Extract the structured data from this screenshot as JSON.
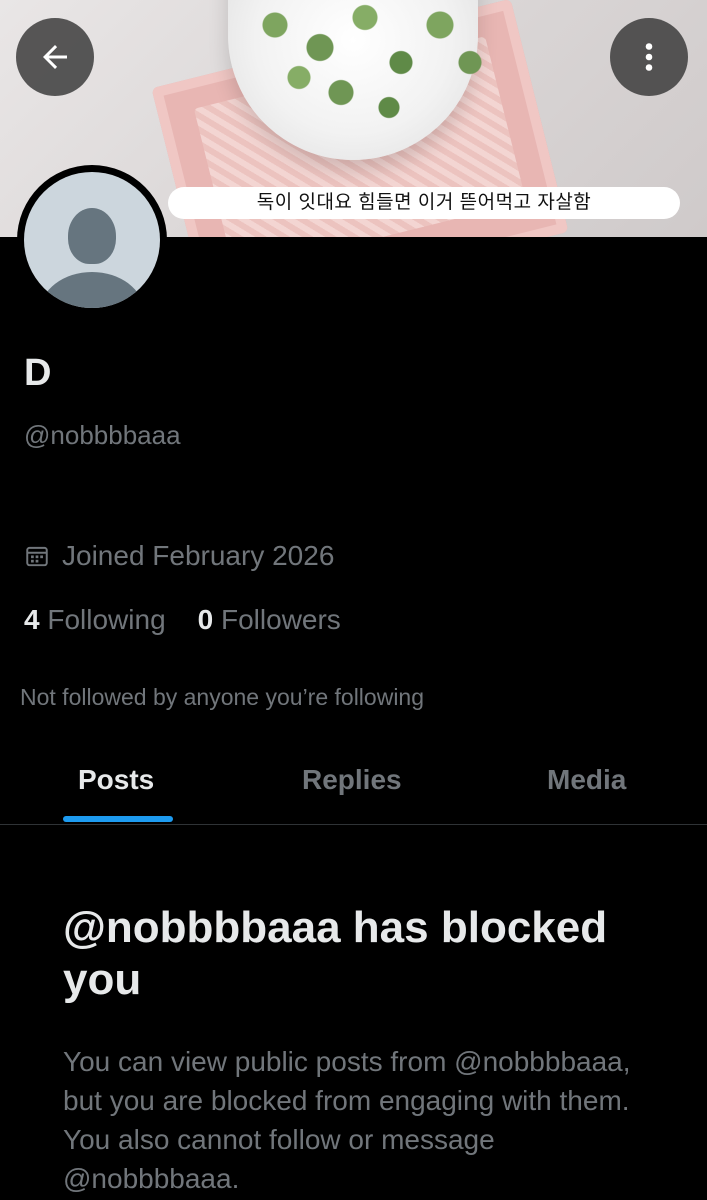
{
  "banner": {
    "caption": "독이 잇대요 힘들면 이거 뜯어먹고 자살함"
  },
  "header": {
    "back_icon": "arrow-left-icon",
    "more_icon": "more-vertical-icon"
  },
  "profile": {
    "display_name": "D",
    "handle": "@nobbbbaaa",
    "joined_icon": "calendar-icon",
    "joined": "Joined February 2026",
    "following_count": "4",
    "following_label": "Following",
    "followers_count": "0",
    "followers_label": "Followers",
    "mutual_note": "Not followed by anyone you’re following"
  },
  "tabs": [
    {
      "label": "Posts",
      "active": true
    },
    {
      "label": "Replies",
      "active": false
    },
    {
      "label": "Media",
      "active": false
    }
  ],
  "blocked": {
    "title": "@nobbbbaaa has blocked you",
    "description": "You can view public posts from @nobbbbaaa, but you are blocked from engaging with them. You also cannot follow or message @nobbbbaaa."
  },
  "colors": {
    "accent": "#1d9bf0",
    "background": "#000000",
    "primary_text": "#e7e9ea",
    "secondary_text": "#71767b"
  }
}
